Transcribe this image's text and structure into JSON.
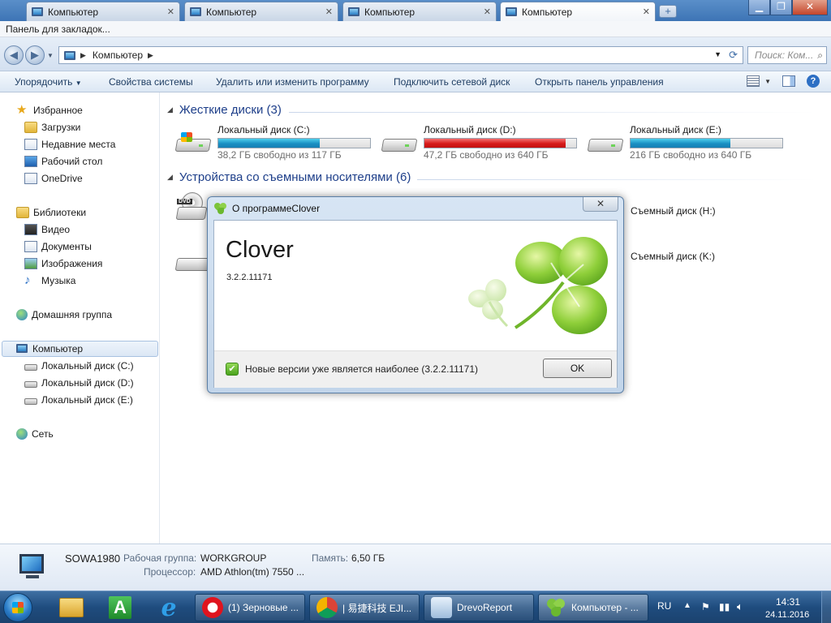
{
  "tabs": [
    {
      "label": "Компьютер"
    },
    {
      "label": "Компьютер"
    },
    {
      "label": "Компьютер"
    },
    {
      "label": "Компьютер"
    }
  ],
  "bookmarks_bar": {
    "label": "Панель для закладок..."
  },
  "address": {
    "crumb": "Компьютер"
  },
  "search": {
    "placeholder": "Поиск: Ком..."
  },
  "toolbar": {
    "organize": "Упорядочить",
    "system_properties": "Свойства системы",
    "uninstall": "Удалить или изменить программу",
    "map_drive": "Подключить сетевой диск",
    "control_panel": "Открыть панель управления"
  },
  "sidebar": {
    "favorites": "Избранное",
    "downloads": "Загрузки",
    "recent": "Недавние места",
    "desktop": "Рабочий стол",
    "onedrive": "OneDrive",
    "libraries": "Библиотеки",
    "video": "Видео",
    "documents": "Документы",
    "images": "Изображения",
    "music": "Музыка",
    "homegroup": "Домашняя группа",
    "computer": "Компьютер",
    "drive_c": "Локальный диск (C:)",
    "drive_d": "Локальный диск (D:)",
    "drive_e": "Локальный диск (E:)",
    "network": "Сеть"
  },
  "groups": {
    "hard_disks": "Жесткие диски (3)",
    "removable": "Устройства со съемными носителями (6)"
  },
  "disks": [
    {
      "name": "Локальный диск (C:)",
      "free": "38,2 ГБ свободно из 117 ГБ",
      "used_fraction": 0.67,
      "color": "blue"
    },
    {
      "name": "Локальный диск (D:)",
      "free": "47,2 ГБ свободно из 640 ГБ",
      "used_fraction": 0.93,
      "color": "red"
    },
    {
      "name": "Локальный диск (E:)",
      "free": "216 ГБ свободно из 640 ГБ",
      "used_fraction": 0.66,
      "color": "blue"
    }
  ],
  "removable": {
    "drive_h": "Съемный диск (H:)",
    "drive_k": "Съемный диск (K:)",
    "dvd_label": "DVD"
  },
  "details": {
    "pc_name": "SOWA1980",
    "workgroup_label": "Рабочая группа:",
    "workgroup": "WORKGROUP",
    "memory_label": "Память:",
    "memory": "6,50 ГБ",
    "cpu_label": "Процессор:",
    "cpu": "AMD Athlon(tm) 7550 ..."
  },
  "dialog": {
    "title": "О программеClover",
    "app_name": "Clover",
    "version": "3.2.2.11171",
    "status": "Новые версии  уже является наиболее (3.2.2.11171)",
    "ok": "OK"
  },
  "taskbar": {
    "pinned_a_letter": "A",
    "buttons": [
      {
        "label": "(1) Зерновые ..."
      },
      {
        "label": "| 易捷科技 EJI..."
      },
      {
        "label": "DrevoReport"
      },
      {
        "label": "Компьютер - ..."
      }
    ],
    "lang": "RU",
    "time": "14:31",
    "date": "24.11.2016"
  },
  "colors": {
    "disk_blue": "#1a8fc2",
    "disk_red": "#d61b1b",
    "accent": "#1e3f8a"
  }
}
